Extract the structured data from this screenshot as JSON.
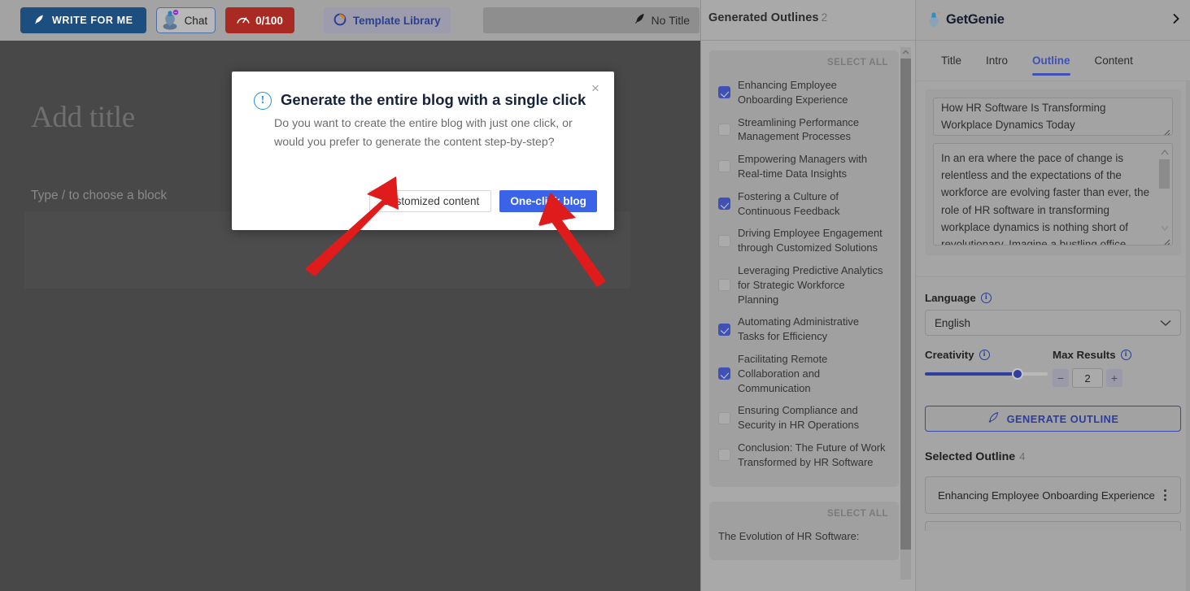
{
  "editor": {
    "toolbar": {
      "write_for_me": "WRITE FOR ME",
      "chat": "Chat",
      "credits": "0/100",
      "template_library": "Template Library",
      "title_value": "No Title"
    },
    "title_placeholder": "Add title",
    "block_hint": "Type / to choose a block"
  },
  "modal": {
    "title": "Generate the entire blog with a single click",
    "body": "Do you want to create the entire blog with just one click, or would you prefer to generate the content step-by-step?",
    "customized_label": "Customized content",
    "oneclick_label": "One-click blog",
    "close_label": "×"
  },
  "outlines_panel": {
    "heading": "Generated Outlines",
    "count": "2",
    "select_all": "SELECT ALL",
    "group1": [
      {
        "label": "Enhancing Employee Onboarding Experience",
        "checked": true
      },
      {
        "label": "Streamlining Performance Management Processes",
        "checked": false
      },
      {
        "label": "Empowering Managers with Real-time Data Insights",
        "checked": false
      },
      {
        "label": "Fostering a Culture of Continuous Feedback",
        "checked": true
      },
      {
        "label": "Driving Employee Engagement through Customized Solutions",
        "checked": false
      },
      {
        "label": "Leveraging Predictive Analytics for Strategic Workforce Planning",
        "checked": false
      },
      {
        "label": "Automating Administrative Tasks for Efficiency",
        "checked": true
      },
      {
        "label": "Facilitating Remote Collaboration and Communication",
        "checked": true
      },
      {
        "label": "Ensuring Compliance and Security in HR Operations",
        "checked": false
      },
      {
        "label": "Conclusion: The Future of Work Transformed by HR Software",
        "checked": false
      }
    ],
    "group2_select_all": "SELECT ALL",
    "group2_first_item": "The Evolution of HR Software:"
  },
  "genie": {
    "brand": "GetGenie",
    "tabs": [
      {
        "label": "Title",
        "active": false
      },
      {
        "label": "Intro",
        "active": false
      },
      {
        "label": "Outline",
        "active": true
      },
      {
        "label": "Content",
        "active": false
      }
    ],
    "title_textarea": "How HR Software Is Transforming Workplace Dynamics Today",
    "intro_textarea": "In an era where the pace of change is relentless and the expectations of the workforce are evolving faster than ever, the role of HR software in transforming workplace dynamics is nothing short of revolutionary. Imagine a bustling office",
    "language_label": "Language",
    "language_value": "English",
    "creativity_label": "Creativity",
    "creativity_percent": 73,
    "max_results_label": "Max Results",
    "max_results_value": "2",
    "generate_outline_label": "GENERATE OUTLINE",
    "selected_outline_label": "Selected Outline",
    "selected_outline_count": "4",
    "selected_items": [
      "Enhancing Employee Onboarding Experience"
    ]
  },
  "colors": {
    "accent_blue": "#3f51b5",
    "primary_button": "#3b63e8",
    "credits_red": "#a82a22",
    "write_blue": "#1c4e7f",
    "arrow_red": "#e01b1b"
  }
}
